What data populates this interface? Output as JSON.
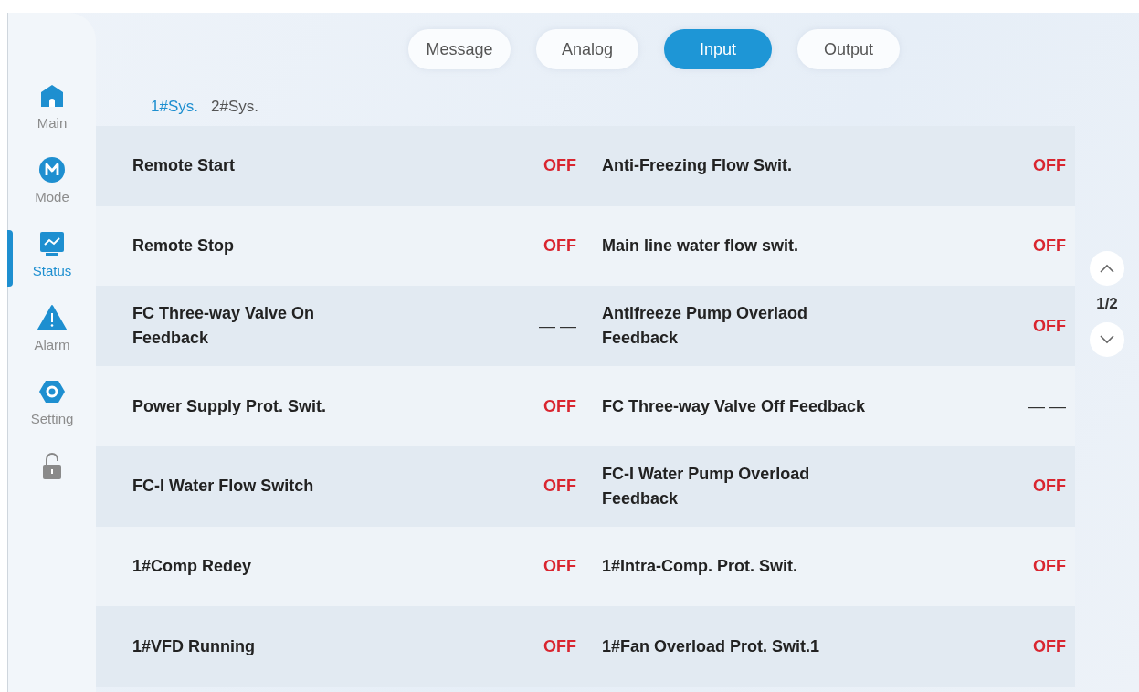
{
  "sidebar": {
    "items": [
      {
        "kind": "home",
        "label": "Main",
        "selected": false
      },
      {
        "kind": "mode",
        "label": "Mode",
        "selected": false
      },
      {
        "kind": "status",
        "label": "Status",
        "selected": true
      },
      {
        "kind": "alarm",
        "label": "Alarm",
        "selected": false
      },
      {
        "kind": "setting",
        "label": "Setting",
        "selected": false
      },
      {
        "kind": "lock",
        "selected": false
      }
    ]
  },
  "tabs": [
    {
      "label": "Message",
      "selected": false
    },
    {
      "label": "Analog",
      "selected": false
    },
    {
      "label": "Input",
      "selected": true
    },
    {
      "label": "Output",
      "selected": false
    }
  ],
  "systems": [
    {
      "label": "1#Sys.",
      "selected": true
    },
    {
      "label": "2#Sys.",
      "selected": false
    }
  ],
  "rows": [
    [
      {
        "name": "Remote Start",
        "value": "OFF",
        "kind": "off"
      },
      {
        "name": "Anti-Freezing Flow Swit.",
        "value": "OFF",
        "kind": "off"
      }
    ],
    [
      {
        "name": "Remote Stop",
        "value": "OFF",
        "kind": "off"
      },
      {
        "name": "Main line water flow swit.",
        "value": "OFF",
        "kind": "off"
      }
    ],
    [
      {
        "name": "FC Three-way Valve On Feedback",
        "value": "— —",
        "kind": "empty"
      },
      {
        "name": "Antifreeze Pump Overlaod Feedback",
        "value": "OFF",
        "kind": "off"
      }
    ],
    [
      {
        "name": "Power Supply Prot. Swit.",
        "value": "OFF",
        "kind": "off"
      },
      {
        "name": "FC Three-way Valve Off Feedback",
        "value": "— —",
        "kind": "empty"
      }
    ],
    [
      {
        "name": "FC-I Water Flow Switch",
        "value": "OFF",
        "kind": "off"
      },
      {
        "name": "FC-I  Water Pump Overload Feedback",
        "value": "OFF",
        "kind": "off"
      }
    ],
    [
      {
        "name": "1#Comp Redey",
        "value": "OFF",
        "kind": "off"
      },
      {
        "name": "1#Intra-Comp. Prot. Swit.",
        "value": "OFF",
        "kind": "off"
      }
    ],
    [
      {
        "name": "1#VFD Running",
        "value": "OFF",
        "kind": "off"
      },
      {
        "name": "1#Fan Overload Prot. Swit.1",
        "value": "OFF",
        "kind": "off"
      }
    ]
  ],
  "pager": {
    "page": "1/2"
  }
}
